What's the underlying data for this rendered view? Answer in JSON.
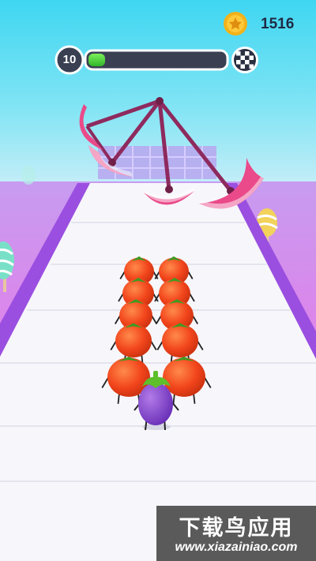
{
  "hud": {
    "coins": "1516",
    "level": "10",
    "progress": 0.12,
    "icons": {
      "coin": "coin-icon",
      "finish": "checkered-flag-icon"
    },
    "colors": {
      "progress_fill": "#44cc33",
      "progress_track": "#3a3f52",
      "coin": "#f2b21a"
    }
  },
  "scene": {
    "obstacle": "swinging-axe-blades",
    "player": {
      "front": "eggplant",
      "crowd": "tomatoes",
      "tomato_count": 10
    },
    "colors": {
      "sky": "#3fd6f2",
      "ground": "#ff5fe0",
      "track": "#f7f7fb",
      "rail": "#9b4fe0",
      "blade": "#ea4a8a",
      "pillar": "#8e2a5e"
    }
  },
  "watermark": {
    "title": "下载鸟应用",
    "url": "www.xiazainiao.com"
  }
}
